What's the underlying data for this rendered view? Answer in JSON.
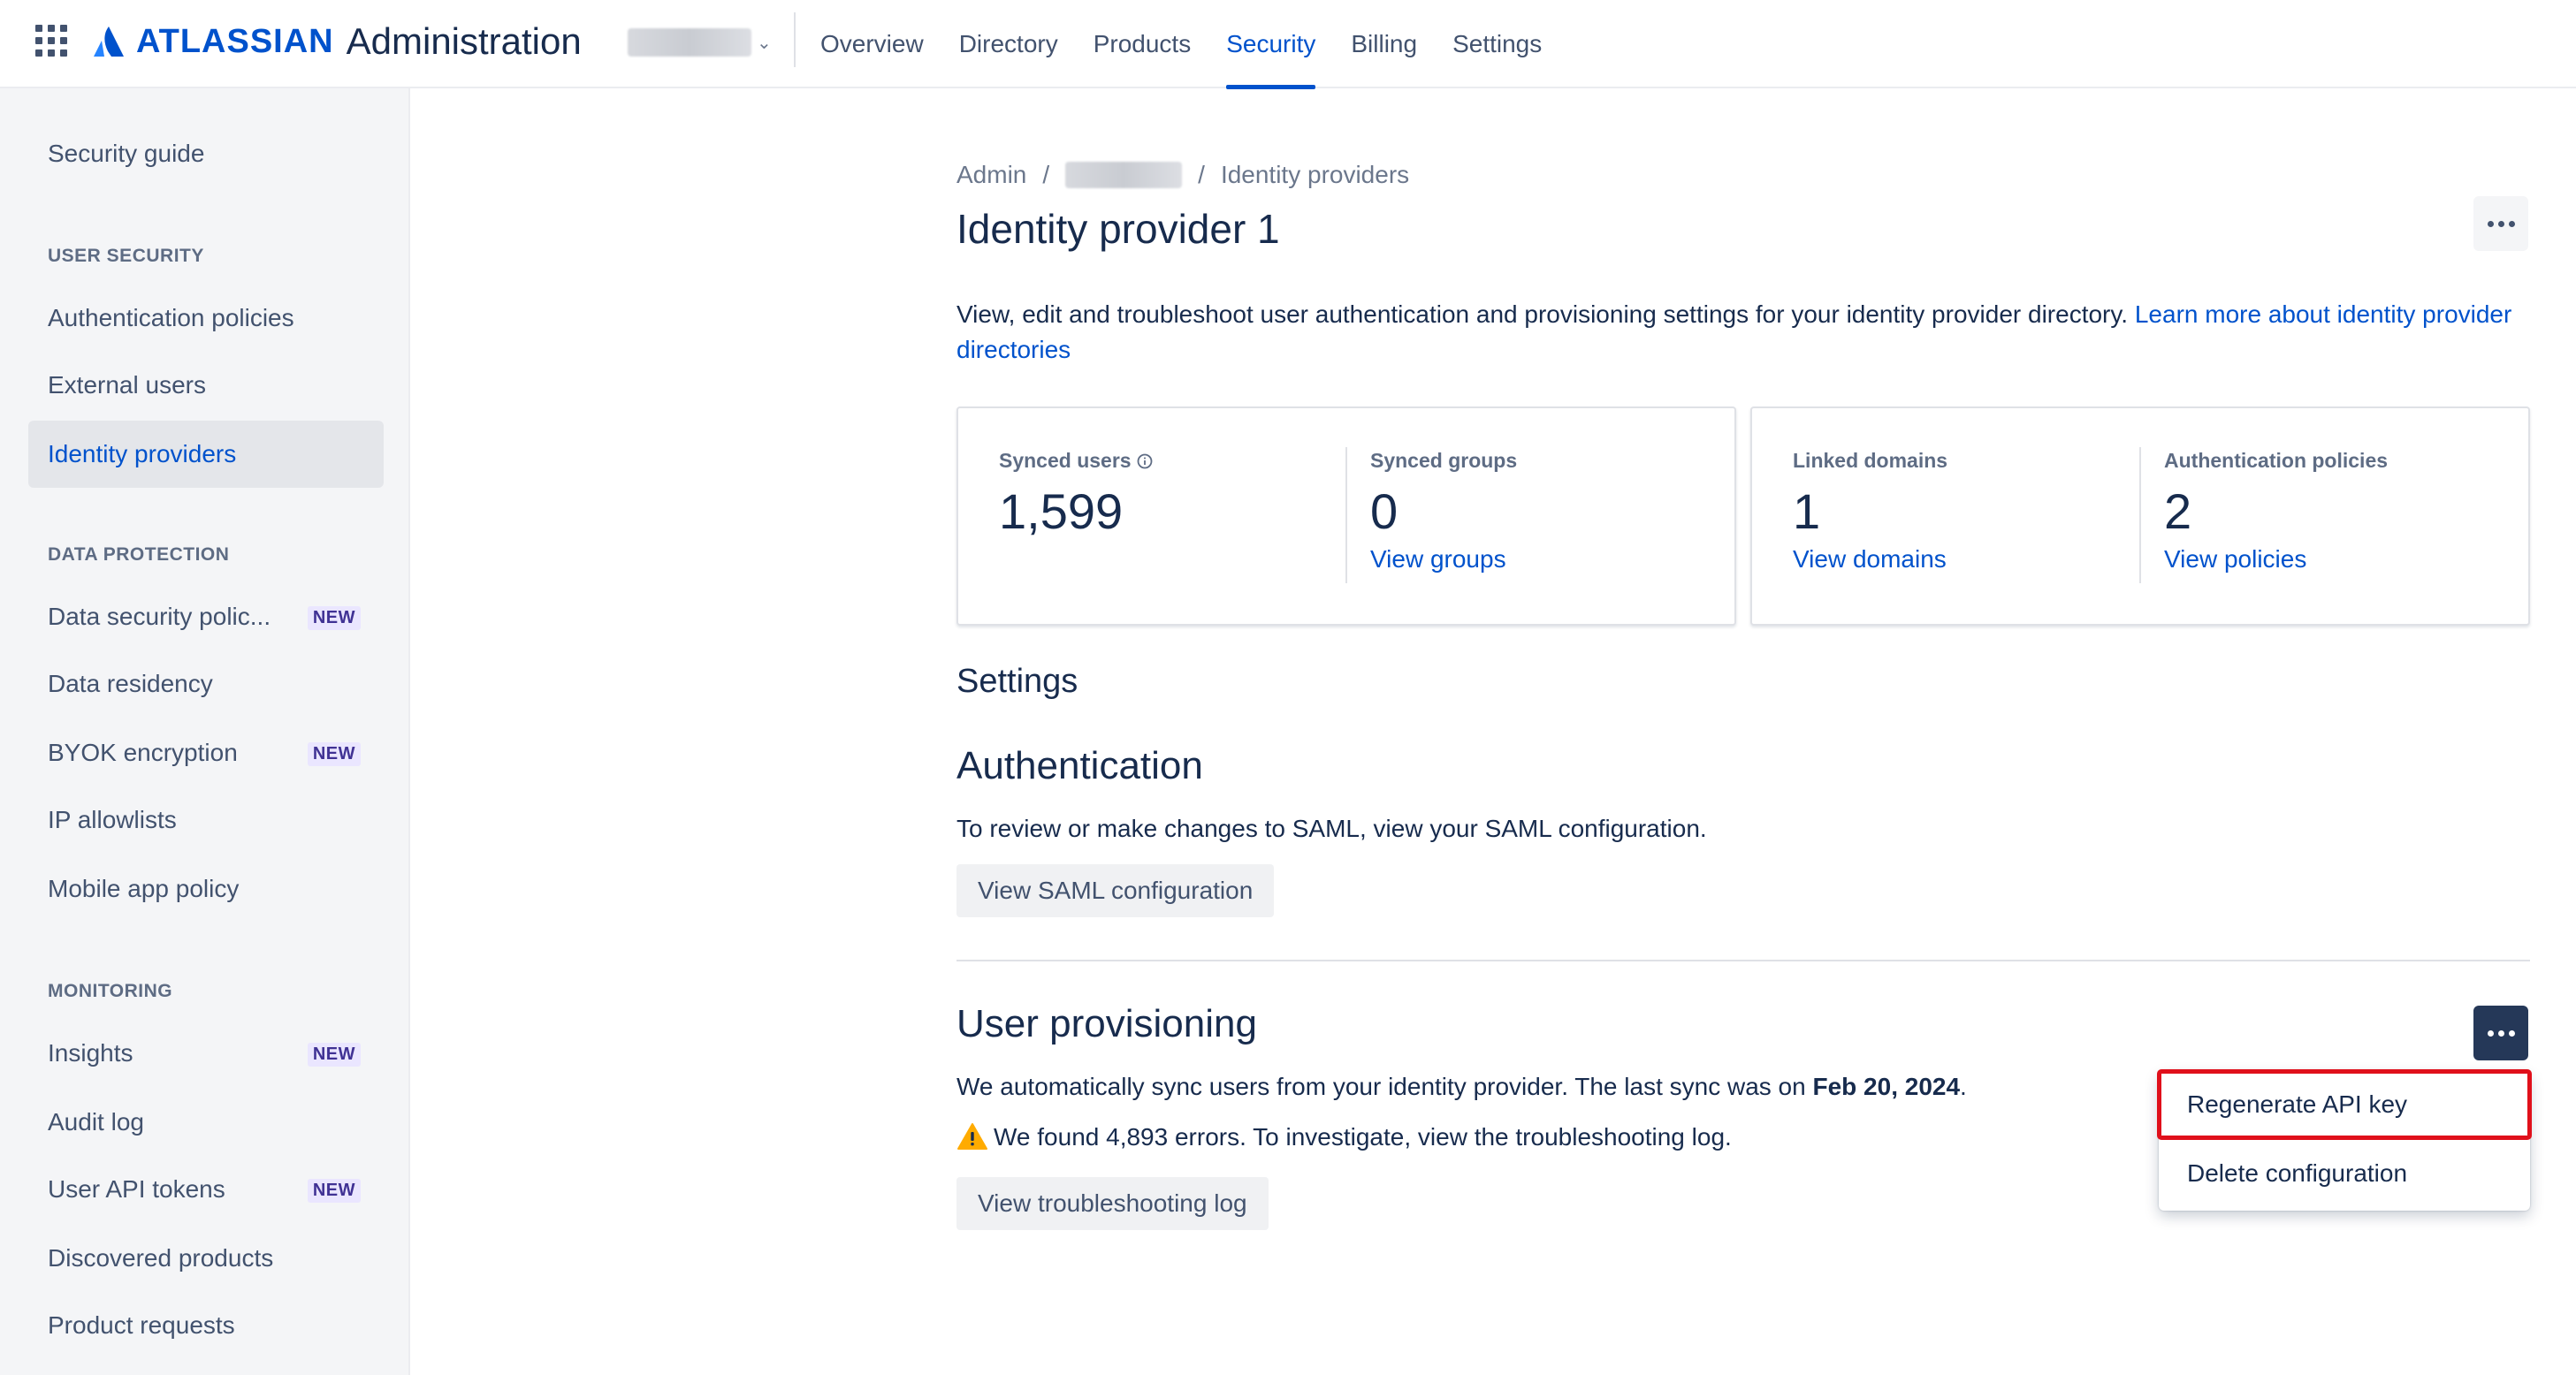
{
  "topbar": {
    "brand": "ATLASSIAN",
    "product": "Administration",
    "nav": [
      {
        "label": "Overview"
      },
      {
        "label": "Directory"
      },
      {
        "label": "Products"
      },
      {
        "label": "Security"
      },
      {
        "label": "Billing"
      },
      {
        "label": "Settings"
      }
    ],
    "active_nav": "Security"
  },
  "sidebar": {
    "top_item": "Security guide",
    "sections": [
      {
        "heading": "USER SECURITY",
        "items": [
          {
            "label": "Authentication policies"
          },
          {
            "label": "External users"
          },
          {
            "label": "Identity providers"
          }
        ]
      },
      {
        "heading": "DATA PROTECTION",
        "items": [
          {
            "label": "Data security polic...",
            "badge": "NEW"
          },
          {
            "label": "Data residency"
          },
          {
            "label": "BYOK encryption",
            "badge": "NEW"
          },
          {
            "label": "IP allowlists"
          },
          {
            "label": "Mobile app policy"
          }
        ]
      },
      {
        "heading": "MONITORING",
        "items": [
          {
            "label": "Insights",
            "badge": "NEW"
          },
          {
            "label": "Audit log"
          },
          {
            "label": "User API tokens",
            "badge": "NEW"
          },
          {
            "label": "Discovered products"
          },
          {
            "label": "Product requests"
          }
        ]
      }
    ],
    "active_item": "Identity providers"
  },
  "breadcrumb": {
    "root": "Admin",
    "sep": "/",
    "current": "Identity providers"
  },
  "page": {
    "title": "Identity provider 1",
    "description": "View, edit and troubleshoot user authentication and provisioning settings for your identity provider directory.",
    "learn_more": "Learn more about identity provider directories"
  },
  "stats": {
    "synced_users": {
      "label": "Synced users",
      "value": "1,599"
    },
    "synced_groups": {
      "label": "Synced groups",
      "value": "0",
      "link": "View groups"
    },
    "linked_domains": {
      "label": "Linked domains",
      "value": "1",
      "link": "View domains"
    },
    "auth_policies": {
      "label": "Authentication policies",
      "value": "2",
      "link": "View policies"
    }
  },
  "settings": {
    "heading": "Settings",
    "authentication": {
      "heading": "Authentication",
      "text": "To review or make changes to SAML, view your SAML configuration.",
      "button": "View SAML configuration"
    },
    "provisioning": {
      "heading": "User provisioning",
      "text_prefix": "We automatically sync users from your identity provider. The last sync was on",
      "last_sync": "Feb 20, 2024",
      "text_suffix": ".",
      "warning": "We found 4,893 errors. To investigate, view the troubleshooting log.",
      "button": "View troubleshooting log"
    }
  },
  "menu": {
    "items": [
      {
        "label": "Regenerate API key"
      },
      {
        "label": "Delete configuration"
      }
    ]
  },
  "colors": {
    "brand_blue": "#0052cc",
    "text": "#172b4d",
    "highlight_red": "#e0101b",
    "warning_yellow": "#ffab00"
  }
}
